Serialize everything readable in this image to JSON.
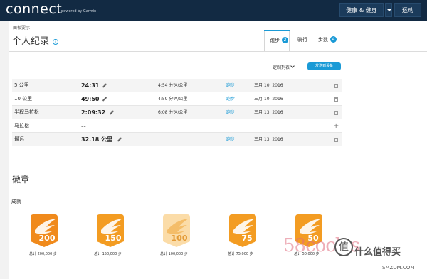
{
  "header": {
    "logo": "connect",
    "logo_sub": "powered by Garmin",
    "nav_health": "健康 & 健身",
    "nav_sports": "运动"
  },
  "breadcrumb": "面板要示",
  "page_title": "个人纪录",
  "help_icon": "?",
  "tabs": [
    {
      "label": "跑步",
      "count": "2",
      "active": true
    },
    {
      "label": "骑行",
      "count": "",
      "active": false
    },
    {
      "label": "步数",
      "count": "4",
      "active": false
    }
  ],
  "toolbar": {
    "customize_label": "定制列表",
    "send_label": "发送到设备"
  },
  "records": [
    {
      "name": "5 公里",
      "value": "24:31",
      "pace": "4:54 分钟/公里",
      "activity": "跑步",
      "date": "三月 10, 2016",
      "action": "trash"
    },
    {
      "name": "10 公里",
      "value": "49:50",
      "pace": "4:59 分钟/公里",
      "activity": "跑步",
      "date": "三月 10, 2016",
      "action": "trash"
    },
    {
      "name": "半程马拉松",
      "value": "2:09:32",
      "pace": "6:08 分钟/公里",
      "activity": "跑步",
      "date": "三月 13, 2016",
      "action": "trash"
    },
    {
      "name": "马拉松",
      "value": "--",
      "pace": "--",
      "activity": "",
      "date": "",
      "action": "plus"
    },
    {
      "name": "最远",
      "value": "32.18 公里",
      "pace": "",
      "activity": "跑步",
      "date": "三月 13, 2016",
      "action": "trash"
    }
  ],
  "badges_section": {
    "title": "徽章",
    "subtitle": "成就",
    "items": [
      {
        "number": "200",
        "caption": "总计 200,000 步",
        "color": "#f08a1c",
        "dark": "#c9650a"
      },
      {
        "number": "150",
        "caption": "总计 150,000 步",
        "color": "#f39c22",
        "dark": "#d07a10"
      },
      {
        "number": "100",
        "caption": "总计 100,000 步",
        "color": "#fbdca8",
        "dark": "#f3b962"
      },
      {
        "number": "75",
        "caption": "总计 75,000 步",
        "color": "#f39c22",
        "dark": "#d07a10"
      },
      {
        "number": "50",
        "caption": "总计 50,000 步",
        "color": "#f39c22",
        "dark": "#d07a10"
      }
    ]
  },
  "watermark": {
    "text": "58cocles",
    "site_text": "什么值得买",
    "site_url": "SMZDM.COM"
  }
}
